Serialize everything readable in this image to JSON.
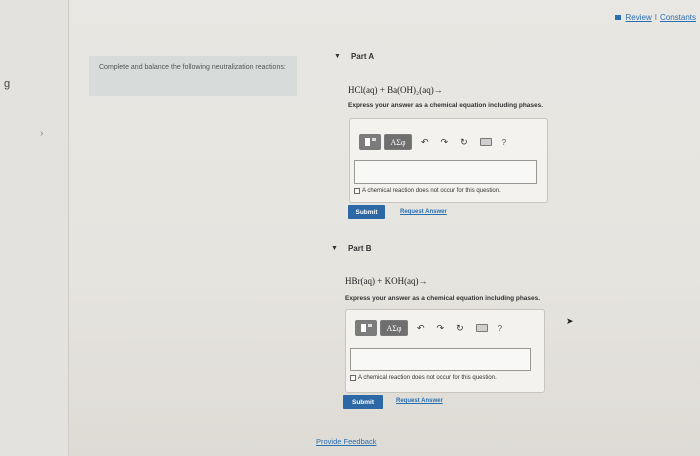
{
  "left_strip": {
    "fragment": "g",
    "chevron": "›"
  },
  "header_links": {
    "review": "Review",
    "separator": "I",
    "constants": "Constants"
  },
  "instructions": "Complete and balance the following neutralization reactions:",
  "parts": [
    {
      "label": "Part A",
      "equation": "HCl(aq) + Ba(OH)₂(aq)→",
      "prompt": "Express your answer as a chemical equation including phases.",
      "toolbar": {
        "greek": "ΑΣφ",
        "help": "?"
      },
      "input_value": "",
      "no_reaction_label": "A chemical reaction does not occur for this question.",
      "submit": "Submit",
      "request_answer": "Request Answer"
    },
    {
      "label": "Part B",
      "equation": "HBr(aq) + KOH(aq)→",
      "prompt": "Express your answer as a chemical equation including phases.",
      "toolbar": {
        "greek": "ΑΣφ",
        "help": "?"
      },
      "input_value": "",
      "no_reaction_label": "A chemical reaction does not occur for this question.",
      "submit": "Submit",
      "request_answer": "Request Answer"
    }
  ],
  "feedback": "Provide Feedback",
  "icons": [
    "template-icon",
    "greek-icon",
    "undo-icon",
    "redo-icon",
    "reset-icon",
    "keyboard-icon",
    "help-icon",
    "triangle-down-icon",
    "cursor-icon"
  ]
}
